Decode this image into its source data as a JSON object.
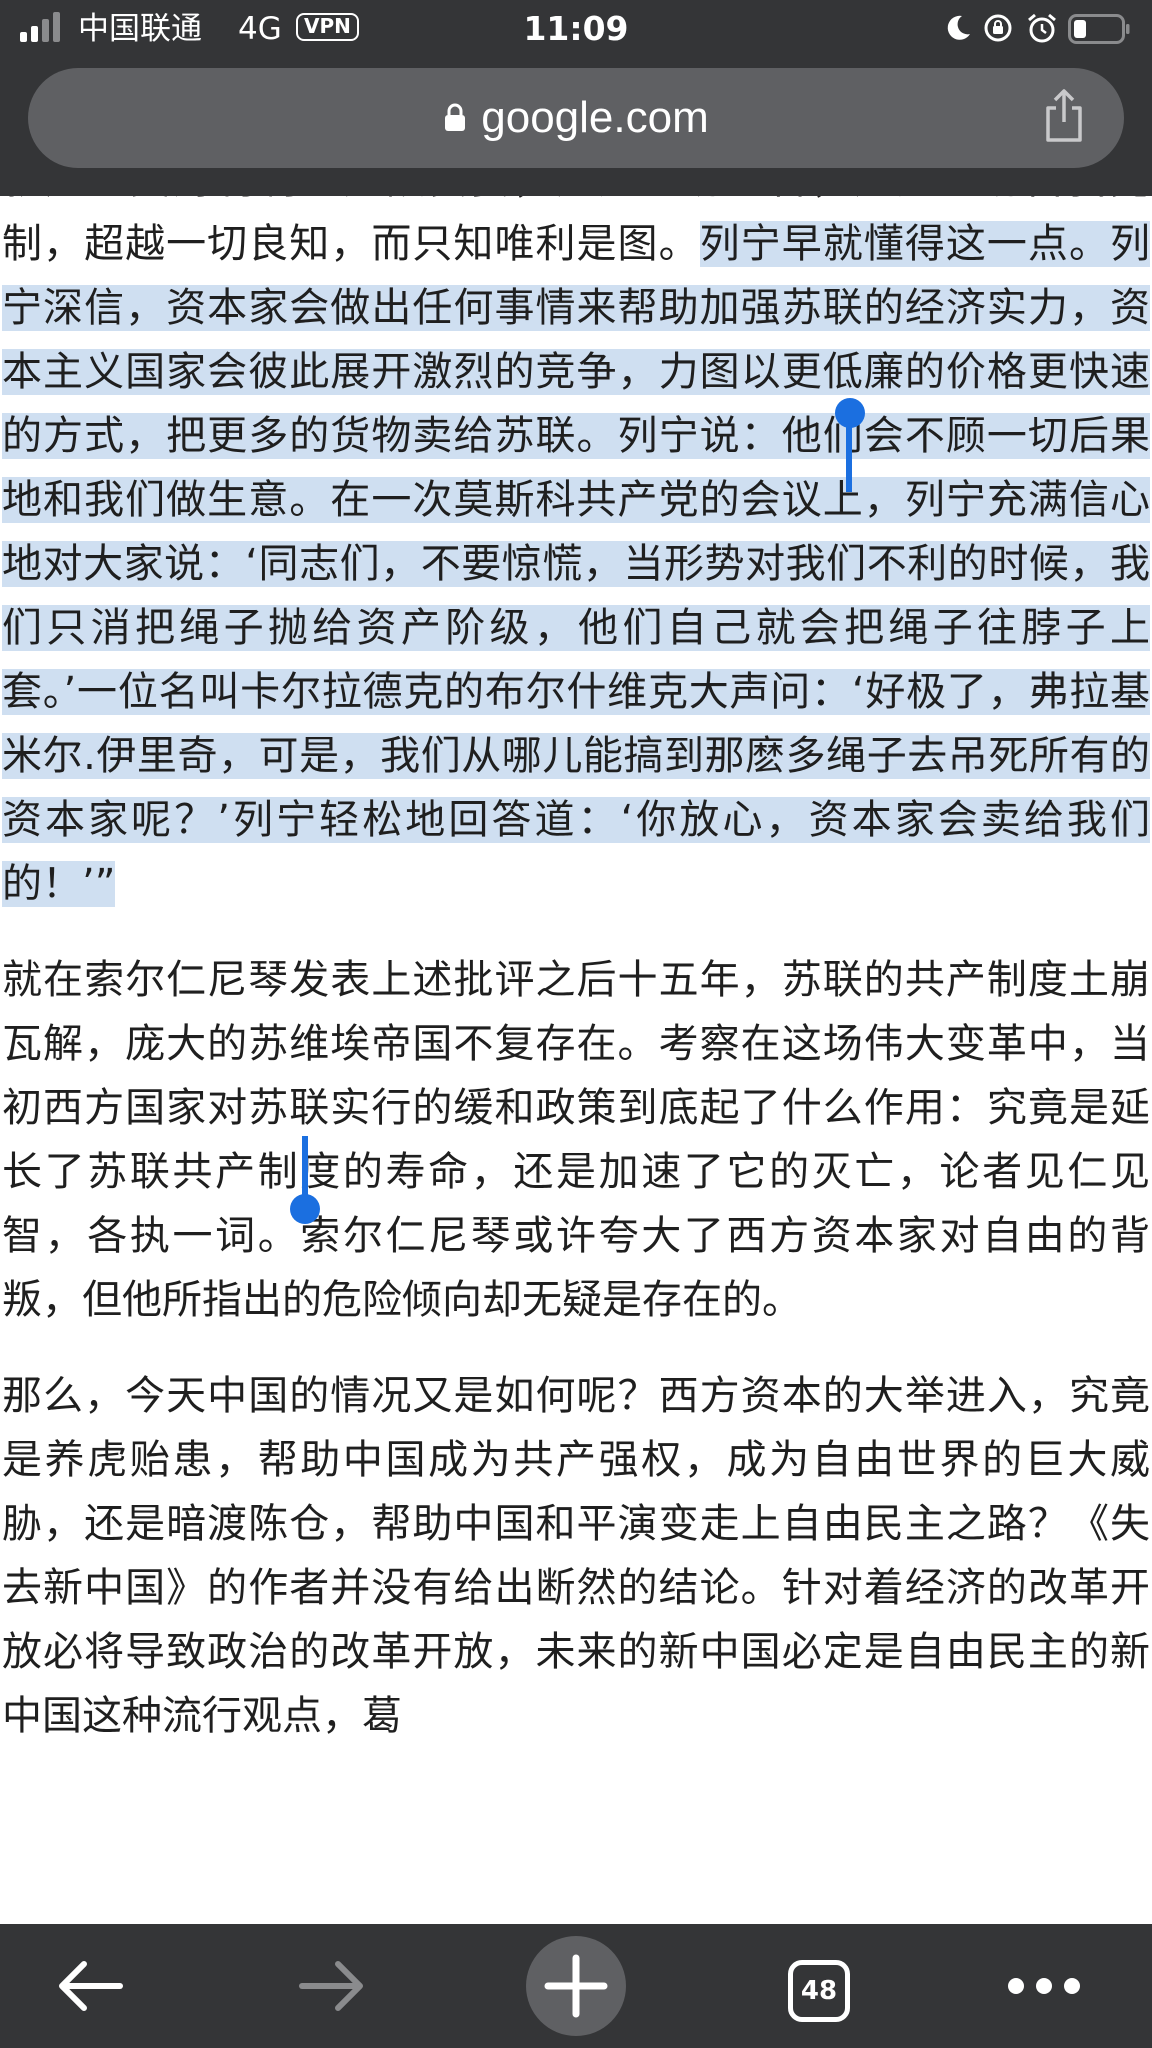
{
  "status_bar": {
    "carrier": "中国联通",
    "network": "4G",
    "vpn": "VPN",
    "time": "11:09",
    "icons": [
      "signal-icon",
      "moon-icon",
      "orientation-lock-icon",
      "alarm-icon",
      "battery-icon"
    ]
  },
  "address_bar": {
    "url": "google.com",
    "icons": [
      "lock-icon",
      "share-icon"
    ]
  },
  "article": {
    "p1_before": "就是人类对利润的无限贪婪，超越一切理智，超越一切自我克制，超越一切良知，而只知唯利是图。",
    "p1_selected": "列宁早就懂得这一点。列宁深信，资本家会做出任何事情来帮助加强苏联的经济实力，资本主义国家会彼此展开激烈的竞争，力图以更低廉的价格更快速的方式，把更多的货物卖给苏联。列宁说：他们会不顾一切后果地和我们做生意。在一次莫斯科共产党的会议上，列宁充满信心地对大家说：‘同志们，不要惊慌，当形势对我们不利的时候，我们只消把绳子抛给资产阶级，他们自己就会把绳子往脖子上套。’一位名叫卡尔拉德克的布尔什维克大声问：‘好极了，弗拉基米尔.伊里奇，可是，我们从哪儿能搞到那麽多绳子去吊死所有的资本家呢？’列宁轻松地回答道：‘你放心，资本家会卖给我们的！’”",
    "p2": "就在索尔仁尼琴发表上述批评之后十五年，苏联的共产制度土崩瓦解，庞大的苏维埃帝国不复存在。考察在这场伟大变革中，当初西方国家对苏联实行的缓和政策到底起了什么作用：究竟是延长了苏联共产制度的寿命，还是加速了它的灭亡，论者见仁见智，各执一词。索尔仁尼琴或许夸大了西方资本家对自由的背叛，但他所指出的危险倾向却无疑是存在的。",
    "p3": "那么，今天中国的情况又是如何呢？西方资本的大举进入，究竟是养虎贻患，帮助中国成为共产强权，成为自由世界的巨大威胁，还是暗渡陈仓，帮助中国和平演变走上自由民主之路？《失去新中国》的作者并没有给出断然的结论。针对着经济的改革开放必将导致政治的改革开放，未来的新中国必定是自由民主的新中国这种流行观点，葛"
  },
  "toolbar": {
    "tab_count": "48",
    "icons": [
      "back-arrow-icon",
      "forward-arrow-icon",
      "plus-icon",
      "tab-switcher-icon",
      "more-dots-icon"
    ],
    "forward_disabled_color": "#8a8b8d"
  },
  "colors": {
    "chrome": "#343537",
    "url_pill": "#5f6063",
    "selection_bg": "#cfdff1",
    "selection_handle": "#1b6fe0"
  }
}
